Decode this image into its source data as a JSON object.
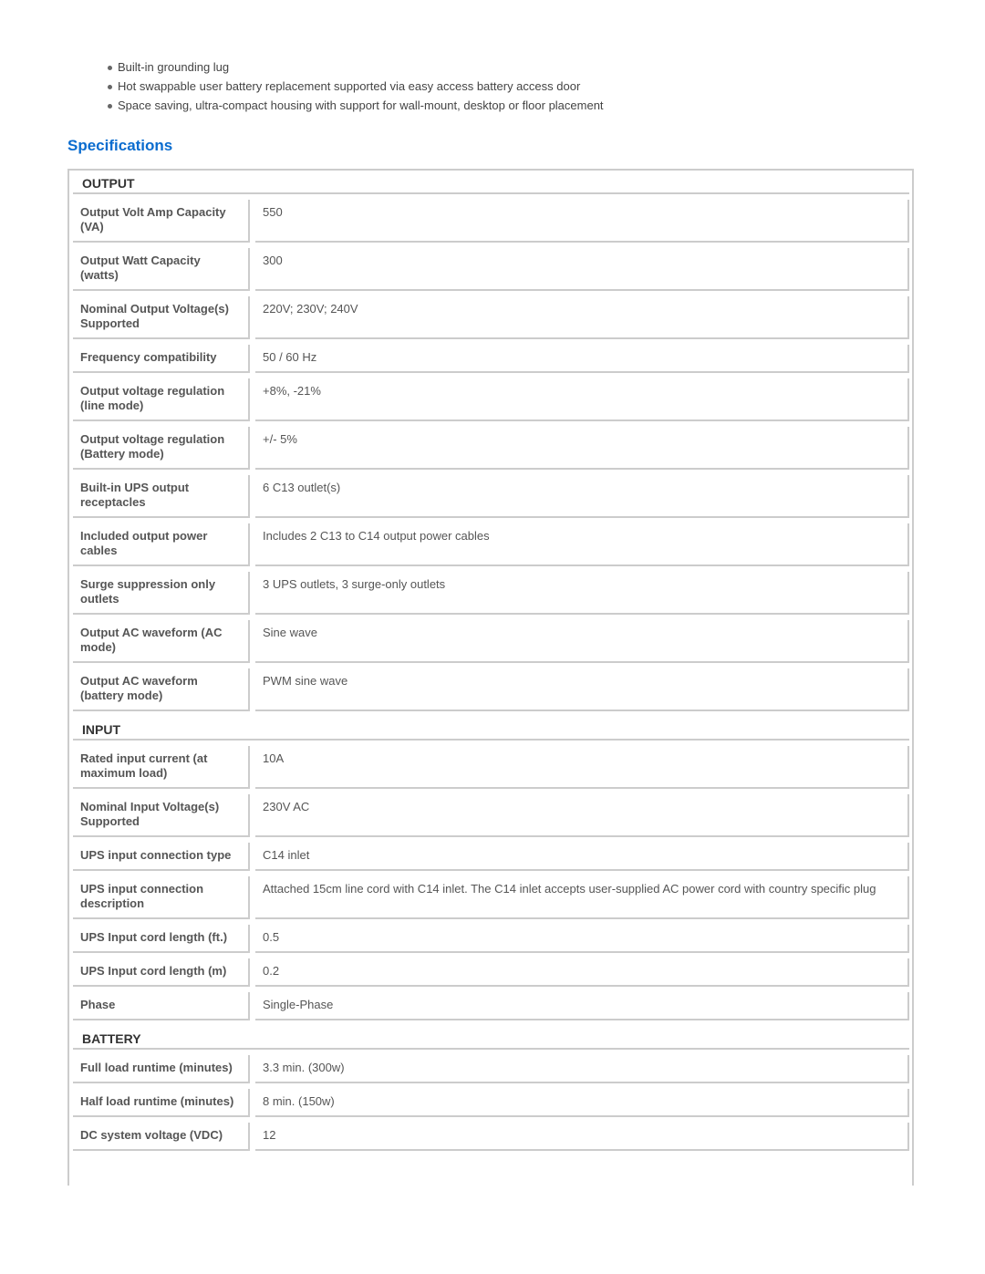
{
  "features": [
    "Built-in grounding lug",
    "Hot swappable user battery replacement supported via easy access battery access door",
    "Space saving, ultra-compact housing with support for wall-mount, desktop or floor placement"
  ],
  "title": "Specifications",
  "sections": [
    {
      "name": "OUTPUT",
      "rows": [
        [
          "Output Volt Amp Capacity (VA)",
          "550"
        ],
        [
          "Output Watt Capacity (watts)",
          "300"
        ],
        [
          "Nominal Output Voltage(s) Supported",
          "220V; 230V; 240V"
        ],
        [
          "Frequency compatibility",
          "50 / 60 Hz"
        ],
        [
          "Output voltage regulation (line mode)",
          "+8%, -21%"
        ],
        [
          "Output voltage regulation (Battery mode)",
          "+/- 5%"
        ],
        [
          "Built-in UPS output receptacles",
          "6 C13 outlet(s)"
        ],
        [
          "Included output power cables",
          "Includes 2 C13 to C14 output power cables"
        ],
        [
          "Surge suppression only outlets",
          "3 UPS outlets, 3 surge-only outlets"
        ],
        [
          "Output AC waveform (AC mode)",
          "Sine wave"
        ],
        [
          "Output AC waveform (battery mode)",
          "PWM sine wave"
        ]
      ]
    },
    {
      "name": "INPUT",
      "rows": [
        [
          "Rated input current (at maximum load)",
          "10A"
        ],
        [
          "Nominal Input Voltage(s) Supported",
          "230V AC"
        ],
        [
          "UPS input connection type",
          "C14 inlet"
        ],
        [
          "UPS input connection description",
          "Attached 15cm line cord with C14 inlet. The C14 inlet accepts user-supplied AC power cord with country specific plug"
        ],
        [
          "UPS Input cord length (ft.)",
          "0.5"
        ],
        [
          "UPS Input cord length (m)",
          "0.2"
        ],
        [
          "Phase",
          "Single-Phase"
        ]
      ]
    },
    {
      "name": "BATTERY",
      "rows": [
        [
          "Full load runtime (minutes)",
          "3.3 min. (300w)"
        ],
        [
          "Half load runtime (minutes)",
          "8 min. (150w)"
        ],
        [
          "DC system voltage (VDC)",
          "12"
        ]
      ]
    }
  ]
}
